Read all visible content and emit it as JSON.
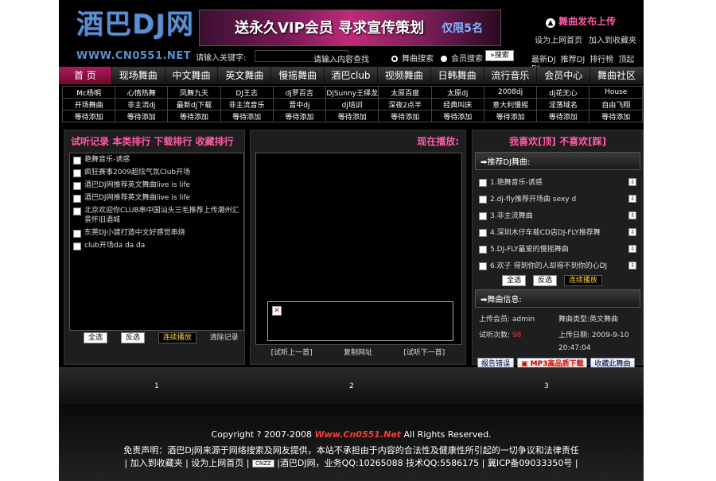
{
  "header": {
    "logo_text": "酒巴DJ网",
    "domain": "WWW.CN0551.NET",
    "banner_text": "送永久VIP会员 寻求宣传策划",
    "banner_badge": "仅限5名",
    "publish_label": "舞曲发布上传",
    "top_links": [
      "设为上网首页",
      "加入到收藏夹"
    ],
    "search_label": "请输入关键字:",
    "search_placeholder": "请输入内容查找",
    "radio_song": "舞曲搜索",
    "radio_member": "会员搜索",
    "search_button": "搜索",
    "right_links": [
      "最新DJ",
      "推荐DJ",
      "排行榜",
      "顶起DJ"
    ]
  },
  "nav": [
    "首 页",
    "现场舞曲",
    "中文舞曲",
    "英文舞曲",
    "慢摇舞曲",
    "酒巴club",
    "视频舞曲",
    "日韩舞曲",
    "流行音乐",
    "会员中心",
    "舞曲社区"
  ],
  "categories": [
    [
      "Mc杨明",
      "心情热舞",
      "凤舞九天",
      "DJ王志",
      "dj罗百吉",
      "DjSunny王绎龙",
      "太原百度",
      "太原dj",
      "2008dj",
      "dj花无心",
      "House"
    ],
    [
      "开场舞曲",
      "非主流dj",
      "最新dj下载",
      "非主流音乐",
      "晋中dj",
      "dj培训",
      "深夜2点半",
      "经典叫床",
      "意大利慢摇",
      "淫荡域名",
      "自由飞翔"
    ],
    [
      "等待添加",
      "等待添加",
      "等待添加",
      "等待添加",
      "等待添加",
      "等待添加",
      "等待添加",
      "等待添加",
      "等待添加",
      "等待添加",
      "等待添加"
    ]
  ],
  "left_panel": {
    "tabs": [
      "试听记录",
      "本类排行",
      "下载排行",
      "收藏排行"
    ],
    "items": [
      "艳舞音乐-诱惑",
      "疯狂赛事2009超炫气氛Club开场",
      "酒巴DJ网推荐英文舞曲live is life",
      "酒巴DJ网推荐英文舞曲live is life",
      "北京欢迎你CLUB串中国汕头三毛推荐上传潮州汇景怀旧酒城",
      "东莞DJ小建打造中文好感觉串烧",
      "club开场da da da"
    ],
    "select_all": "全选",
    "invert": "反选",
    "continuous": "连续播放",
    "clear": "清除记录"
  },
  "mid_panel": {
    "title": "现在播放:",
    "prev": "[试听上一首]",
    "copy": "复制网址",
    "next": "[试听下一首]"
  },
  "right_panel": {
    "title": "我喜欢[顶] 不喜欢[踩]",
    "rec_title": "推荐DJ舞曲:",
    "songs": [
      "1.艳舞音乐-诱惑",
      "2.dj-fly推荐开场曲 sexy d",
      "3.非主流舞曲",
      "4.深圳木仔车载CD店DJ-FLY推荐舞",
      "5.DJ-FLY最爱的慢摇舞曲",
      "6.欢子 得到你的人却得不到你的心DJ"
    ],
    "select_all": "全选",
    "invert": "反选",
    "continuous": "连续播放",
    "info_title": "舞曲信息:",
    "uploader_label": "上传会员:",
    "uploader": "admin",
    "type_label": "舞曲类型:",
    "type": "英文舞曲",
    "plays_label": "试听次数:",
    "plays": "98",
    "date_label": "上传日期:",
    "date": "2009-9-10",
    "time": "20:47:04",
    "report": "报告错误",
    "mp3": "MP3高品质下载",
    "favorite": "收藏此舞曲"
  },
  "pager": [
    "1",
    "2",
    "3"
  ],
  "footer": {
    "copyright_pre": "Copyright ? 2007-2008",
    "copyright_brand": "Www.Cn0551.Net",
    "copyright_post": "All Rights Reserved.",
    "disclaimer": "免责声明：酒巴Dj网来源于网络搜索及网友提供，本站不承担由于内容的合法性及健康性所引起的一切争议和法律责任",
    "links": "| 加入到收藏夹 | 设为上网首页 |",
    "stat": "CNZZ",
    "contact": "|酒巴DJ网，业务QQ:10265088 技术QQ:5586175 | 冀ICP备09033350号 |"
  }
}
